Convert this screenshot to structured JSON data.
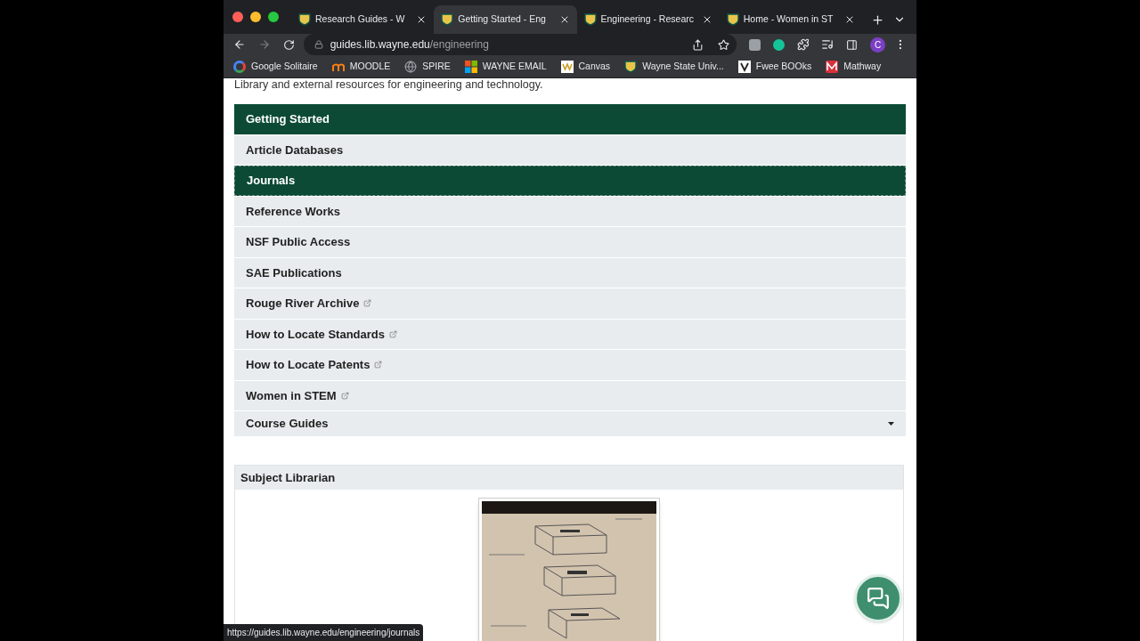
{
  "tabs": [
    {
      "title": "Research Guides - W",
      "selected": false
    },
    {
      "title": "Getting Started - Eng",
      "selected": true
    },
    {
      "title": "Engineering - Researc",
      "selected": false
    },
    {
      "title": "Home - Women in ST",
      "selected": false
    }
  ],
  "address": {
    "host": "guides.lib.wayne.edu",
    "path": "/engineering"
  },
  "profile_initial": "C",
  "bookmarks": [
    {
      "label": "Google Solitaire",
      "kind": "google"
    },
    {
      "label": "MOODLE",
      "kind": "moodle"
    },
    {
      "label": "SPIRE",
      "kind": "globe"
    },
    {
      "label": "WAYNE EMAIL",
      "kind": "windows"
    },
    {
      "label": "Canvas",
      "kind": "canvas"
    },
    {
      "label": "Wayne State Univ...",
      "kind": "shield"
    },
    {
      "label": "Fwee BOOks",
      "kind": "v"
    },
    {
      "label": "Mathway",
      "kind": "mathway"
    }
  ],
  "intro": "Library and external resources for engineering and technology.",
  "nav": [
    {
      "label": "Getting Started",
      "selected": true,
      "hovered": false,
      "external": false
    },
    {
      "label": "Article Databases",
      "selected": false,
      "hovered": false,
      "external": false
    },
    {
      "label": "Journals",
      "selected": false,
      "hovered": true,
      "external": false
    },
    {
      "label": "Reference Works",
      "selected": false,
      "hovered": false,
      "external": false
    },
    {
      "label": "NSF Public Access",
      "selected": false,
      "hovered": false,
      "external": false
    },
    {
      "label": "SAE Publications",
      "selected": false,
      "hovered": false,
      "external": false
    },
    {
      "label": "Rouge River Archive",
      "selected": false,
      "hovered": false,
      "external": true
    },
    {
      "label": "How to Locate Standards",
      "selected": false,
      "hovered": false,
      "external": true
    },
    {
      "label": "How to Locate Patents",
      "selected": false,
      "hovered": false,
      "external": true
    },
    {
      "label": "Women in STEM",
      "selected": false,
      "hovered": false,
      "external": true
    }
  ],
  "dropdown": {
    "label": "Course Guides",
    "expanded": false
  },
  "librarian": {
    "title": "Subject Librarian"
  },
  "status_url": "https://guides.lib.wayne.edu/engineering/journals"
}
